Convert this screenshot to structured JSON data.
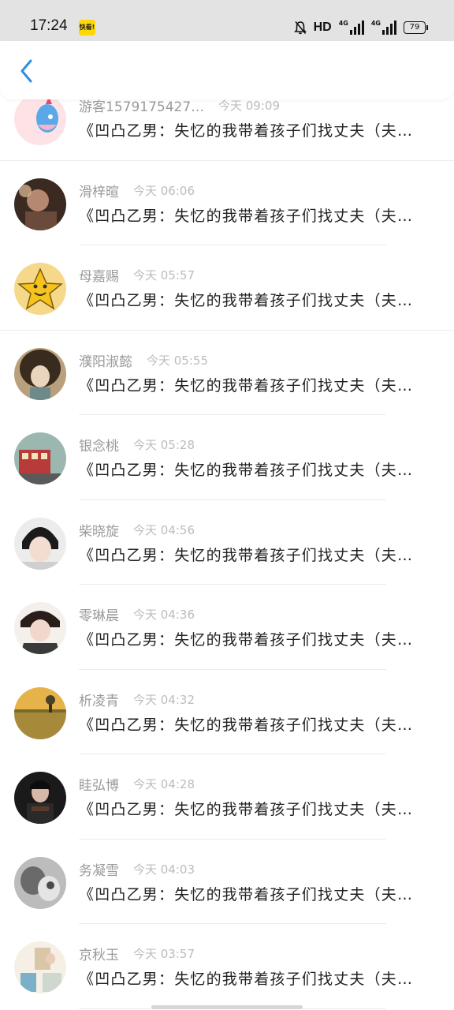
{
  "status_bar": {
    "time": "17:24",
    "app_badge": "快看!",
    "hd_label": "HD",
    "signal_label_1": "4G",
    "signal_label_2": "4G",
    "battery_level": "79"
  },
  "nav": {
    "back_icon": "chevron-left-icon",
    "accent_color": "#2d8ee6"
  },
  "comments": [
    {
      "name": "游客1579175427…",
      "time": "今天 09:09",
      "message": "《凹凸乙男：失忆的我带着孩子们找丈夫（夫…"
    },
    {
      "name": "滑梓暄",
      "time": "今天 06:06",
      "message": "《凹凸乙男：失忆的我带着孩子们找丈夫（夫…"
    },
    {
      "name": "母嘉赐",
      "time": "今天 05:57",
      "message": "《凹凸乙男：失忆的我带着孩子们找丈夫（夫…"
    },
    {
      "name": "濮阳淑懿",
      "time": "今天 05:55",
      "message": "《凹凸乙男：失忆的我带着孩子们找丈夫（夫…"
    },
    {
      "name": "银念桃",
      "time": "今天 05:28",
      "message": "《凹凸乙男：失忆的我带着孩子们找丈夫（夫…"
    },
    {
      "name": "柴晓旋",
      "time": "今天 04:56",
      "message": "《凹凸乙男：失忆的我带着孩子们找丈夫（夫…"
    },
    {
      "name": "零琳晨",
      "time": "今天 04:36",
      "message": "《凹凸乙男：失忆的我带着孩子们找丈夫（夫…"
    },
    {
      "name": "析凌青",
      "time": "今天 04:32",
      "message": "《凹凸乙男：失忆的我带着孩子们找丈夫（夫…"
    },
    {
      "name": "眭弘博",
      "time": "今天 04:28",
      "message": "《凹凸乙男：失忆的我带着孩子们找丈夫（夫…"
    },
    {
      "name": "务凝雪",
      "time": "今天 04:03",
      "message": "《凹凸乙男：失忆的我带着孩子们找丈夫（夫…"
    },
    {
      "name": "京秋玉",
      "time": "今天 03:57",
      "message": "《凹凸乙男：失忆的我带着孩子们找丈夫（夫…"
    }
  ]
}
